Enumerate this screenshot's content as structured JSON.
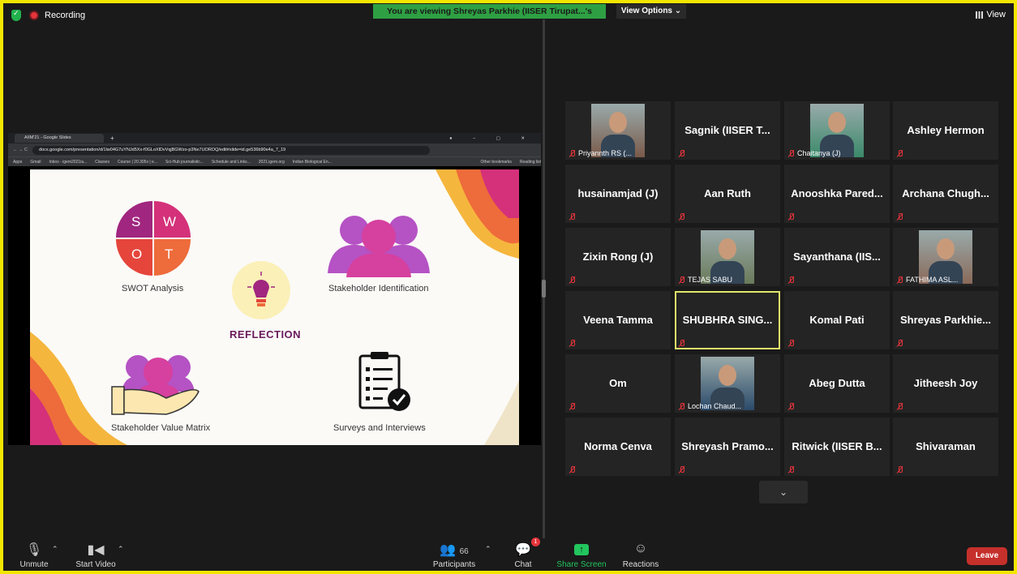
{
  "recording": {
    "label": "Recording"
  },
  "banner": {
    "text": "You are viewing Shreyas Parkhie (IISER Tirupat...'s screen"
  },
  "view_options": {
    "label": "View Options"
  },
  "view_button": {
    "label": "View"
  },
  "shared_browser": {
    "tab_title": "AIIM'21 - Google Slides",
    "url": "docs.google.com/presentation/d/1lw04G7uYNJd5Xx-f0GLoXlDvVqjBGWzo-p3Ne7UOROQ/edit#slide=id.ge536b90e4a_7_19",
    "bookmarks": [
      "Apps",
      "Gmail",
      "Inbox - igem2021ia...",
      "Classes",
      "Course | 20.305x | e...",
      "Sci-Hub journalistic...",
      "Schedule and Links...",
      "2021.igem.org",
      "Indian Biological En...",
      "Other bookmarks",
      "Reading list"
    ]
  },
  "slide": {
    "swot_letters": [
      "S",
      "W",
      "O",
      "T"
    ],
    "swot_label": "SWOT Analysis",
    "stakeholder_id_label": "Stakeholder Identification",
    "reflection_label": "REFLECTION",
    "value_matrix_label": "Stakeholder Value Matrix",
    "surveys_label": "Surveys and Interviews"
  },
  "participants_grid": [
    {
      "name": "Priyannth RS (...",
      "video": true
    },
    {
      "name": "Sagnik (IISER T...",
      "video": false
    },
    {
      "name": "Chaitanya (J)",
      "video": true
    },
    {
      "name": "Ashley Hermon",
      "video": false
    },
    {
      "name": "husainamjad (J)",
      "video": false
    },
    {
      "name": "Aan Ruth",
      "video": false
    },
    {
      "name": "Anooshka Pared...",
      "video": false
    },
    {
      "name": "Archana Chugh...",
      "video": false
    },
    {
      "name": "Zixin Rong (J)",
      "video": false
    },
    {
      "name": "TEJAS SABU",
      "video": true
    },
    {
      "name": "Sayanthana (IIS...",
      "video": false
    },
    {
      "name": "FATHIMA ASL...",
      "video": true
    },
    {
      "name": "Veena Tamma",
      "video": false
    },
    {
      "name": "SHUBHRA SING...",
      "video": false,
      "active_speaker": true
    },
    {
      "name": "Komal Pati",
      "video": false
    },
    {
      "name": "Shreyas Parkhie...",
      "video": false
    },
    {
      "name": "Om",
      "video": false
    },
    {
      "name": "Lochan Chaud...",
      "video": true
    },
    {
      "name": "Abeg Dutta",
      "video": false
    },
    {
      "name": "Jitheesh Joy",
      "video": false
    },
    {
      "name": "Norma Cenva",
      "video": false
    },
    {
      "name": "Shreyash Pramo...",
      "video": false
    },
    {
      "name": "Ritwick (IISER B...",
      "video": false
    },
    {
      "name": "Shivaraman",
      "video": false
    }
  ],
  "toolbar": {
    "unmute": "Unmute",
    "start_video": "Start Video",
    "participants": "Participants",
    "participants_count": "66",
    "chat": "Chat",
    "chat_badge": "1",
    "share_screen": "Share Screen",
    "reactions": "Reactions",
    "leave": "Leave"
  },
  "colors": {
    "border": "#f2e600",
    "banner": "#2ea043",
    "leave": "#c6302b",
    "active_speaker": "#dfe76a"
  }
}
